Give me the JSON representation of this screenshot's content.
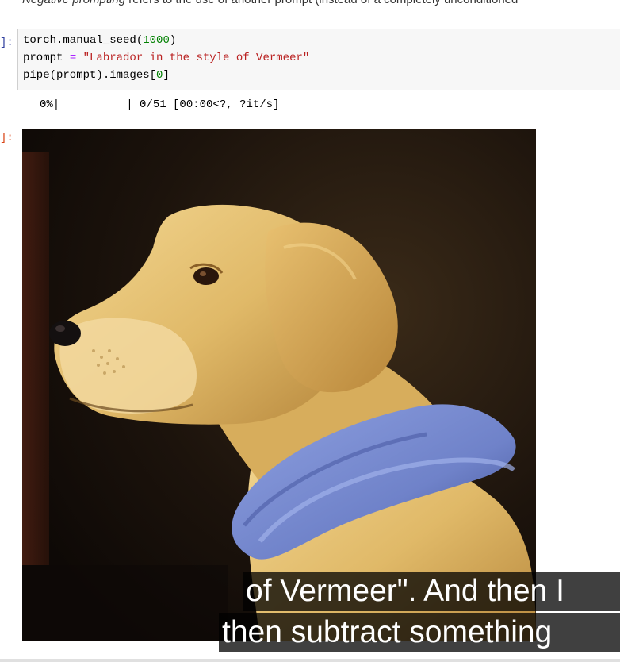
{
  "markdown": {
    "italic_term": "Negative prompting",
    "text": " refers to the use of another prompt (instead of a completely unconditioned"
  },
  "code_cell": {
    "prompt_label": "]:",
    "line1": {
      "prefix": "torch.manual_seed(",
      "num": "1000",
      "suffix": ")"
    },
    "line2": {
      "prefix": "prompt ",
      "op": "=",
      "str": " \"Labrador in the style of Vermeer\""
    },
    "line3": {
      "prefix": "pipe(prompt).images[",
      "idx": "0",
      "suffix": "]"
    }
  },
  "output": {
    "progress": "0%|          | 0/51 [00:00<?, ?it/s]",
    "prompt_label": "]:",
    "image_description": "Labrador dog in profile with blue scarf, painted in the style of Vermeer"
  },
  "subtitles": {
    "line1": "of Vermeer\". And then I",
    "line2": "then subtract something"
  },
  "colors": {
    "background_dark": "#1c130c",
    "fur": "#e0b968",
    "scarf": "#6f82c9"
  }
}
